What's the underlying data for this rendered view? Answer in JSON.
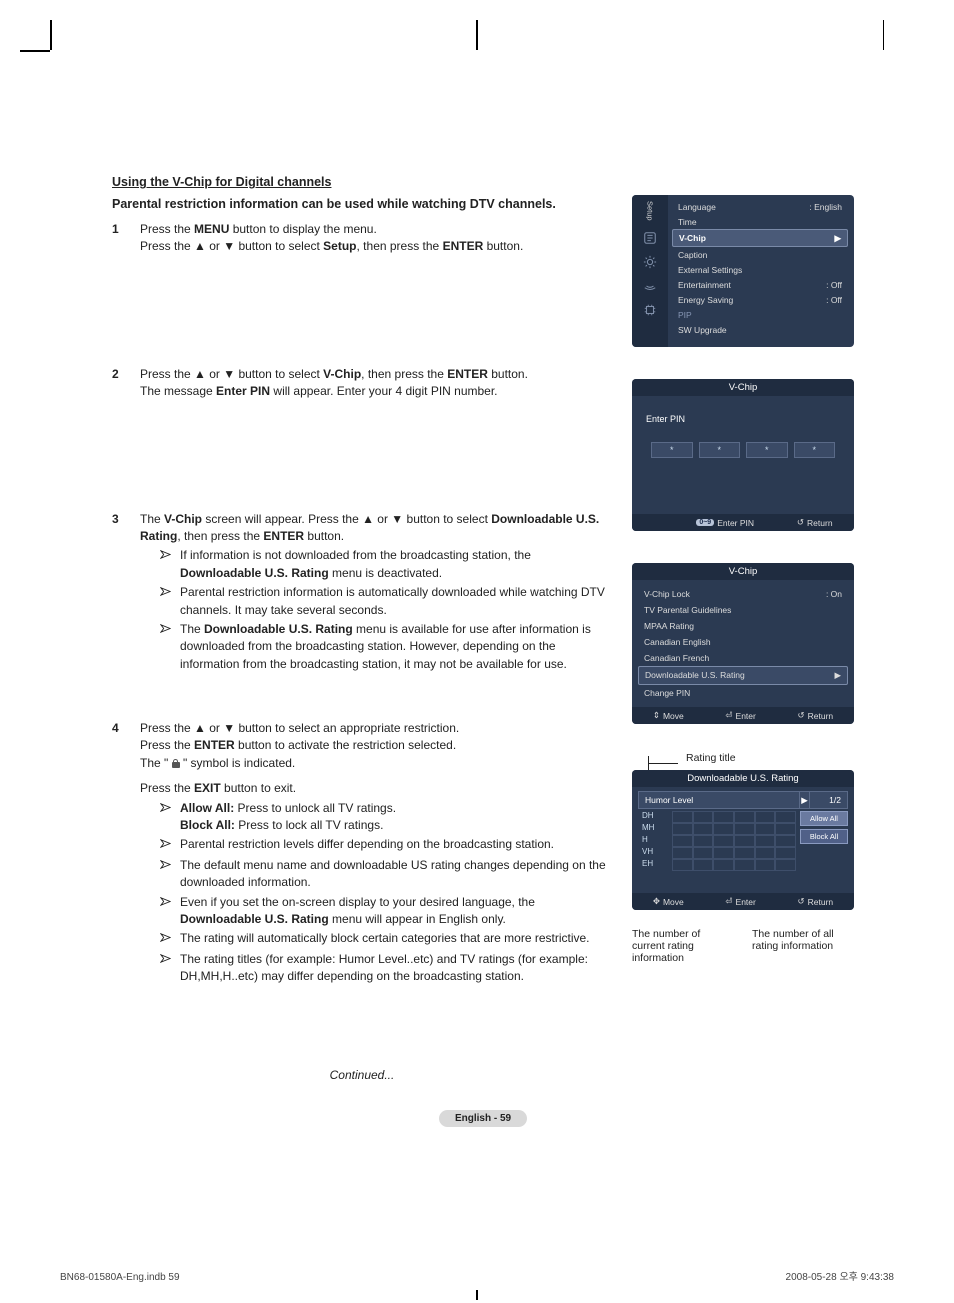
{
  "heading": "Using the V-Chip for Digital channels",
  "intro": "Parental restriction information can be used while watching DTV channels.",
  "steps": {
    "s1": {
      "num": "1",
      "l1a": "Press the ",
      "l1b": "MENU",
      "l1c": " button to display the menu.",
      "l2a": "Press the ▲ or ▼ button to select ",
      "l2b": "Setup",
      "l2c": ", then press the ",
      "l2d": "ENTER",
      "l2e": " button."
    },
    "s2": {
      "num": "2",
      "l1a": "Press the ▲ or ▼ button to select ",
      "l1b": "V-Chip",
      "l1c": ", then press the ",
      "l1d": "ENTER",
      "l1e": " button.",
      "l2a": "The message ",
      "l2b": "Enter PIN",
      "l2c": " will appear. Enter your 4 digit PIN number."
    },
    "s3": {
      "num": "3",
      "l1a": "The ",
      "l1b": "V-Chip",
      "l1c": " screen will appear. Press the ▲ or ▼ button to select ",
      "l2a": "Downloadable U.S. Rating",
      "l2b": ", then press the ",
      "l2c": "ENTER",
      "l2d": " button.",
      "b1a": "If information is not downloaded from the broadcasting station, the ",
      "b1b": "Downloadable U.S. Rating",
      "b1c": " menu is deactivated.",
      "b2": "Parental restriction information is automatically downloaded while watching DTV channels. It may take several seconds.",
      "b3a": "The ",
      "b3b": "Downloadable U.S. Rating",
      "b3c": " menu is available for use after information is downloaded from the broadcasting station. However, depending on the information from the broadcasting station, it may not be available for use."
    },
    "s4": {
      "num": "4",
      "l1": "Press the ▲ or ▼ button to select an appropriate restriction.",
      "l2a": "Press the ",
      "l2b": "ENTER",
      "l2c": " button to activate the restriction selected.",
      "l3a": "The \" ",
      "l3b": " \" symbol is indicated.",
      "l4a": "Press the ",
      "l4b": "EXIT",
      "l4c": " button to exit.",
      "b1a": "Allow All:",
      "b1b": " Press to unlock all TV ratings.",
      "b1c": "Block All:",
      "b1d": " Press to lock all TV ratings.",
      "b2": "Parental restriction levels differ depending on the broadcasting station.",
      "b3": "The default menu name and downloadable US rating changes depending on the downloaded information.",
      "b4a": "Even if you set the on-screen display to your desired language, the ",
      "b4b": "Downloadable U.S. Rating",
      "b4c": " menu will appear in English only.",
      "b5": "The rating will automatically block certain categories that are more restrictive.",
      "b6": "The rating titles (for example: Humor Level..etc) and TV ratings (for example: DH,MH,H..etc) may differ depending on the broadcasting station."
    }
  },
  "continued": "Continued...",
  "pageno": "English - 59",
  "footer_left": "BN68-01580A-Eng.indb   59",
  "footer_right": "2008-05-28   오후 9:43:38",
  "osd": {
    "setup_tab": "Setup",
    "menu": [
      {
        "label": "Language",
        "val": ": English"
      },
      {
        "label": "Time",
        "val": ""
      },
      {
        "label": "V-Chip",
        "val": "▶",
        "sel": true
      },
      {
        "label": "Caption",
        "val": ""
      },
      {
        "label": "External Settings",
        "val": ""
      },
      {
        "label": "Entertainment",
        "val": ": Off"
      },
      {
        "label": "Energy Saving",
        "val": ": Off"
      },
      {
        "label": "PIP",
        "val": "",
        "dim": true
      },
      {
        "label": "SW Upgrade",
        "val": ""
      }
    ],
    "pin_title": "V-Chip",
    "pin_label": "Enter PIN",
    "pin_star": "*",
    "pin_hint_btn": "0~9",
    "pin_hint": "Enter PIN",
    "return": "Return",
    "vchip_title": "V-Chip",
    "vchip": [
      {
        "label": "V-Chip Lock",
        "val": ": On"
      },
      {
        "label": "TV Parental Guidelines",
        "val": ""
      },
      {
        "label": "MPAA Rating",
        "val": ""
      },
      {
        "label": "Canadian English",
        "val": ""
      },
      {
        "label": "Canadian French",
        "val": ""
      },
      {
        "label": "Downloadable U.S. Rating",
        "val": "▶",
        "sel": true
      },
      {
        "label": "Change PIN",
        "val": ""
      }
    ],
    "move": "Move",
    "enter": "Enter",
    "rate_title": "Downloadable U.S. Rating",
    "rate_header": "Humor Level",
    "rate_page": "1/2",
    "rate_rows": [
      "DH",
      "MH",
      "H",
      "VH",
      "EH"
    ],
    "allow": "Allow All",
    "block": "Block All",
    "ann_title": "Rating title",
    "below_left": "The number of current rating information",
    "below_right": "The number of all rating information"
  }
}
